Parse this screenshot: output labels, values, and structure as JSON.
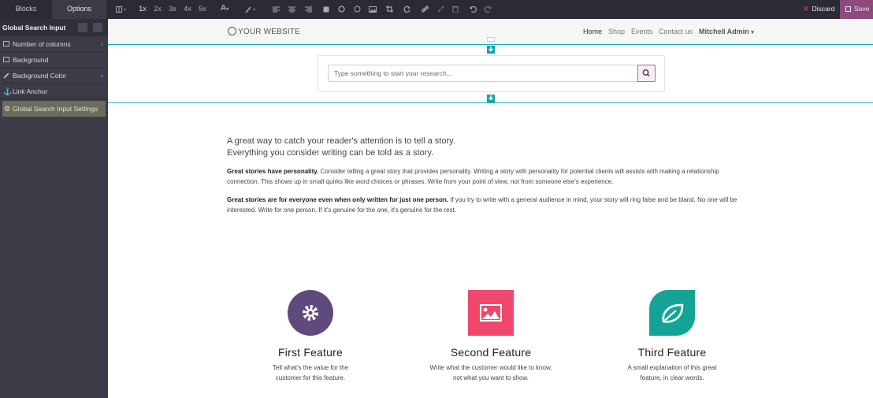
{
  "toolbar": {
    "tabs": {
      "blocks": "Blocks",
      "options": "Options"
    },
    "sizes": [
      "1x",
      "2x",
      "3x",
      "4x",
      "5x"
    ],
    "discard": "Discard",
    "save": "Save",
    "accent": "#8b4b7c"
  },
  "sidebar": {
    "title": "Global Search Input",
    "items": [
      {
        "label": "Number of columns",
        "icon": "columns-icon"
      },
      {
        "label": "Background",
        "icon": "image-icon"
      },
      {
        "label": "Background Color",
        "icon": "paint-brush-icon"
      },
      {
        "label": "Link Anchor",
        "icon": "anchor-icon"
      },
      {
        "label": "Global Search Input Settings",
        "icon": "gear-icon"
      }
    ]
  },
  "site": {
    "logo": "YOUR WEBSITE",
    "menu": [
      "Home",
      "Shop",
      "Events",
      "Contact us",
      "Mitchell Admin"
    ],
    "search_placeholder": "Type something to start your research...",
    "lead_1": "A great way to catch your reader's attention is to tell a story.",
    "lead_2": "Everything you consider writing can be told as a story.",
    "p1_bold": "Great stories have personality.",
    "p1_text": " Consider telling a great story that provides personality. Writing a story with personality for potential clients will assists with making a relationship connection. This shows up in small quirks like word choices or phrases. Write from your point of view, not from someone else's experience.",
    "p2_bold": "Great stories are for everyone even when only written for just one person.",
    "p2_text": " If you try to write with a general audience in mind, your story will ring false and be bland. No one will be interested. Write for one person. If it's genuine for the one, it's genuine for the rest.",
    "features": [
      {
        "title": "First Feature",
        "line1": "Tell what's the value for the",
        "line2": "customer for this feature.",
        "color": "#5e4a7d"
      },
      {
        "title": "Second Feature",
        "line1": "Write what the customer would like to know,",
        "line2": "not what you want to show.",
        "color": "#f0476e"
      },
      {
        "title": "Third Feature",
        "line1": "A small explanation of this great",
        "line2": "feature, in clear words.",
        "color": "#13a497"
      }
    ]
  }
}
